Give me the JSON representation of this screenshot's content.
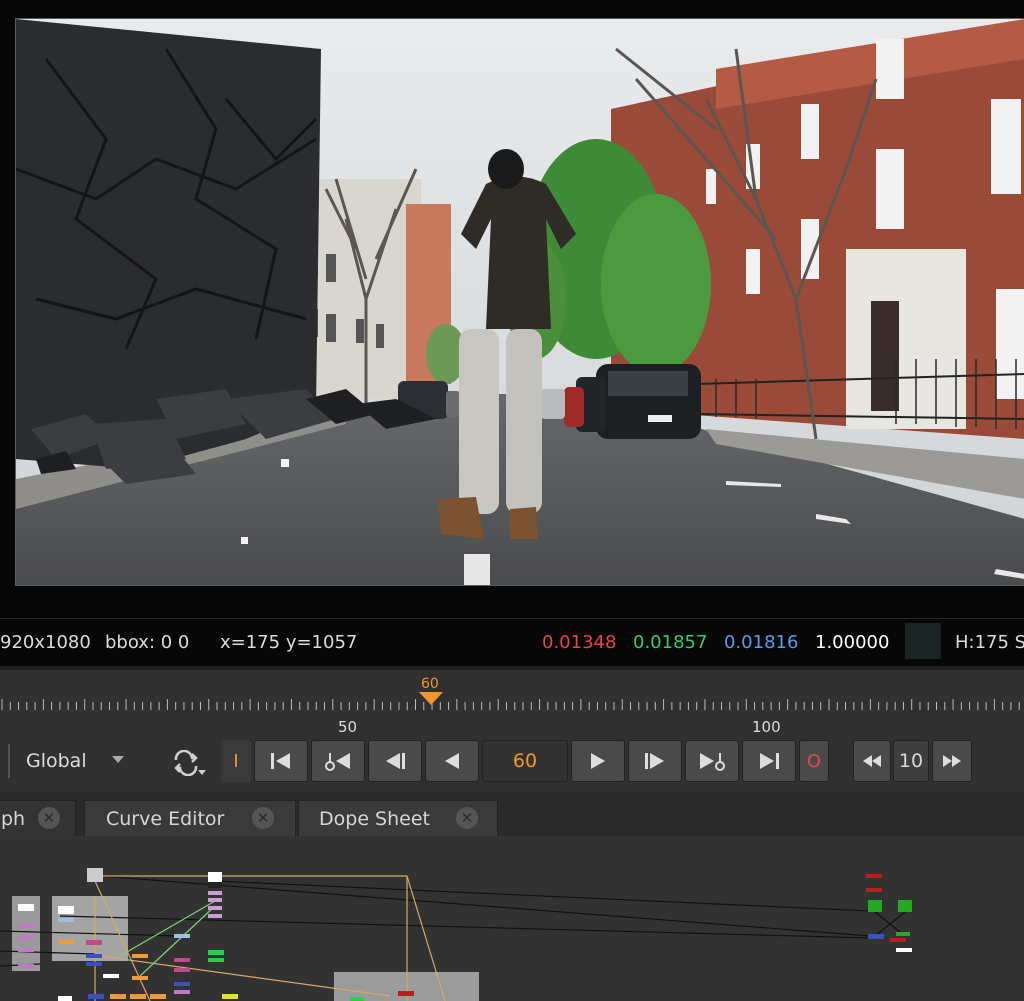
{
  "info_bar": {
    "format": "920x1080",
    "bbox": "bbox: 0 0",
    "coords": "x=175 y=1057",
    "r": "0.01348",
    "g": "0.01857",
    "b": "0.01816",
    "a": "1.00000",
    "hsv": "H:175 S"
  },
  "timeline": {
    "current_frame_marker": "60",
    "ruler_labels": [
      "50",
      "100"
    ]
  },
  "transport": {
    "mode": "Global",
    "in_point": "I",
    "frame": "60",
    "out_point": "O",
    "increment": "10"
  },
  "tabs": {
    "node_graph": "ph",
    "curve_editor": "Curve Editor",
    "dope_sheet": "Dope Sheet",
    "close": "✕"
  },
  "colors": {
    "red_channel": "#e8424a",
    "green_channel": "#33cc66",
    "blue_channel": "#5b9bea",
    "accent_orange": "#f0962a"
  }
}
